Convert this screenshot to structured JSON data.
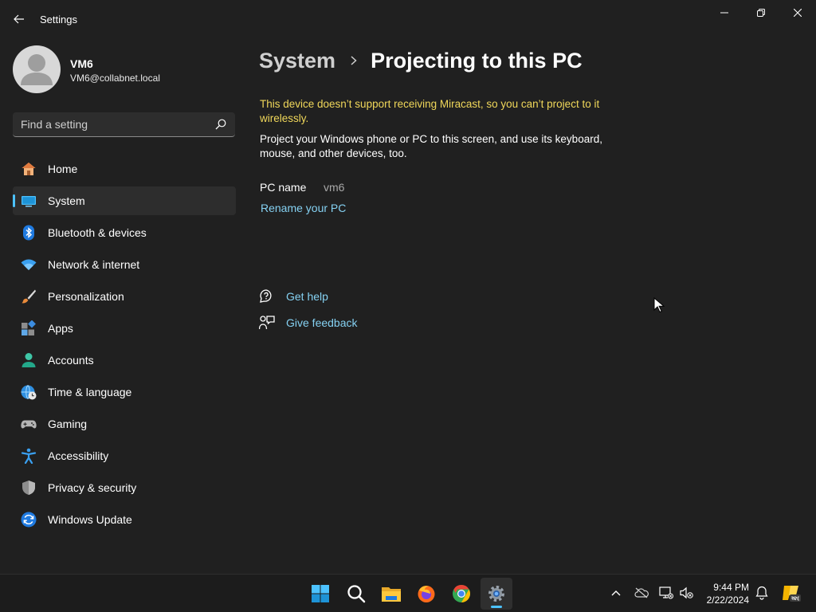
{
  "window": {
    "title": "Settings"
  },
  "profile": {
    "name": "VM6",
    "email": "VM6@collabnet.local"
  },
  "search": {
    "placeholder": "Find a setting"
  },
  "nav": {
    "items": [
      {
        "label": "Home"
      },
      {
        "label": "System"
      },
      {
        "label": "Bluetooth & devices"
      },
      {
        "label": "Network & internet"
      },
      {
        "label": "Personalization"
      },
      {
        "label": "Apps"
      },
      {
        "label": "Accounts"
      },
      {
        "label": "Time & language"
      },
      {
        "label": "Gaming"
      },
      {
        "label": "Accessibility"
      },
      {
        "label": "Privacy & security"
      },
      {
        "label": "Windows Update"
      }
    ],
    "selected": "System"
  },
  "breadcrumb": {
    "parent": "System",
    "current": "Projecting to this PC"
  },
  "main": {
    "warning": "This device doesn’t support receiving Miracast, so you can’t project to it wirelessly.",
    "description": "Project your Windows phone or PC to this screen, and use its keyboard, mouse, and other devices, too.",
    "pc_name_label": "PC name",
    "pc_name_value": "vm6",
    "rename_link": "Rename your PC",
    "get_help": "Get help",
    "give_feedback": "Give feedback"
  },
  "taskbar": {
    "time": "9:44 PM",
    "date": "2/22/2024",
    "apps": [
      "windows-start-icon",
      "search-icon",
      "file-explorer-icon",
      "firefox-icon",
      "chrome-icon",
      "settings-icon"
    ]
  },
  "colors": {
    "background": "#202020",
    "accent": "#4cc2ff",
    "link": "#85d1f2",
    "warning": "#f0d75a"
  }
}
